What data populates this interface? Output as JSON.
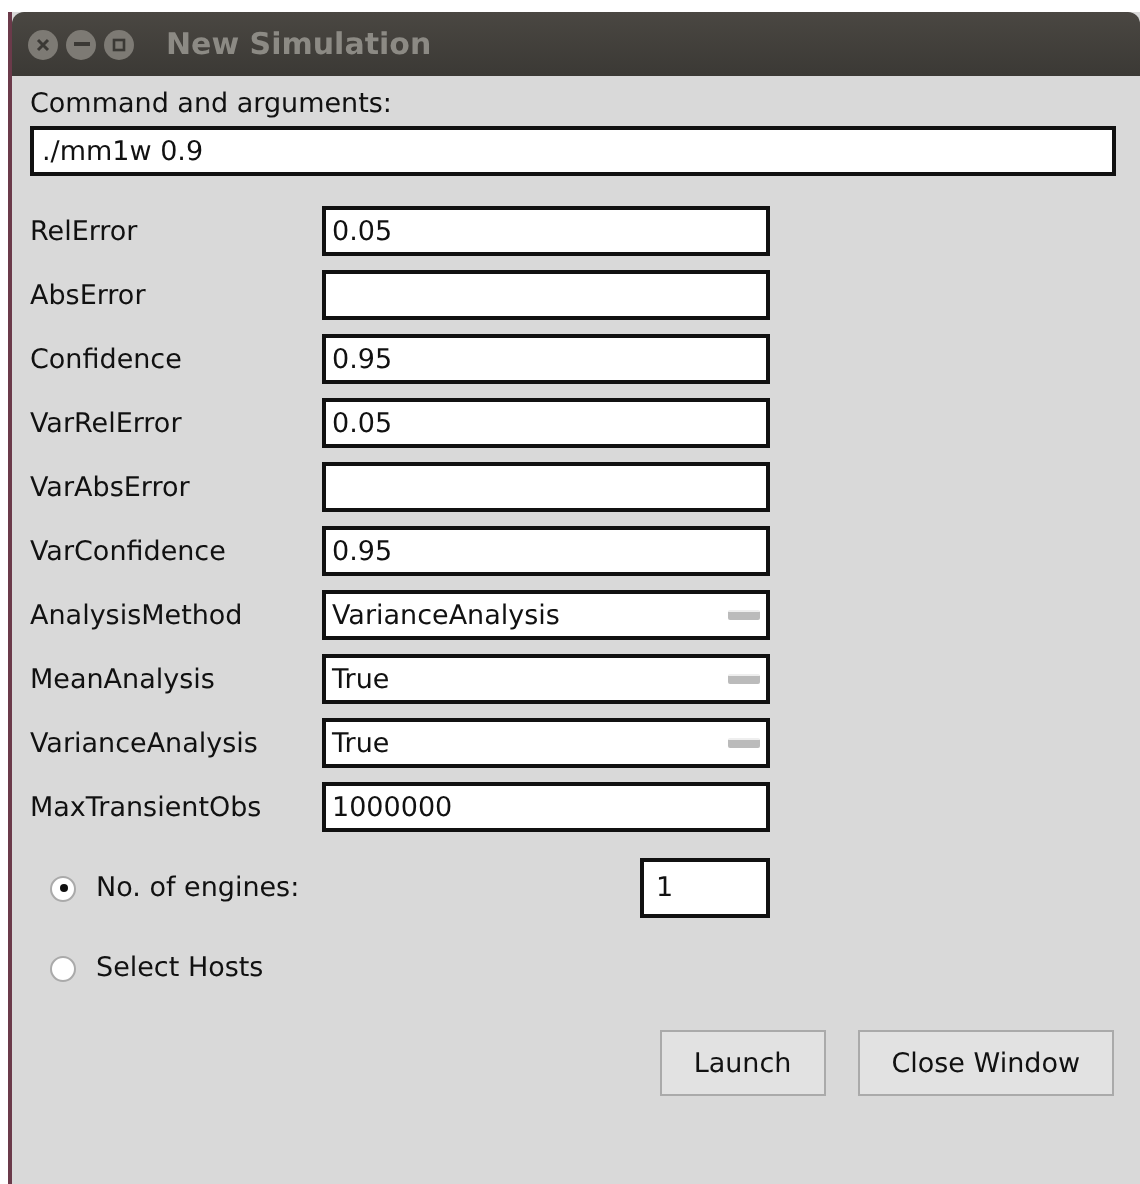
{
  "window": {
    "title": "New Simulation"
  },
  "command": {
    "label": "Command and arguments:",
    "value": "./mm1w 0.9"
  },
  "parameters": [
    {
      "label": "RelError",
      "kind": "text",
      "value": "0.05"
    },
    {
      "label": "AbsError",
      "kind": "text"
    },
    {
      "label": "Confidence",
      "kind": "text",
      "value": "0.95"
    },
    {
      "label": "VarRelError",
      "kind": "text",
      "value": "0.05"
    },
    {
      "label": "VarAbsError",
      "kind": "text"
    },
    {
      "label": "VarConfidence",
      "kind": "text",
      "value": "0.95"
    },
    {
      "label": "AnalysisMethod",
      "kind": "dropdown",
      "value": "VarianceAnalysis"
    },
    {
      "label": "MeanAnalysis",
      "kind": "dropdown",
      "value": "True"
    },
    {
      "label": "VarianceAnalysis",
      "kind": "dropdown",
      "value": "True"
    },
    {
      "label": "MaxTransientObs",
      "kind": "text",
      "value": "1000000"
    }
  ],
  "host_options": [
    {
      "label": "No. of engines:",
      "selected": true,
      "value": "1"
    },
    {
      "label": "Select Hosts",
      "selected": false
    }
  ],
  "buttons": [
    "Launch",
    "Close Window"
  ]
}
